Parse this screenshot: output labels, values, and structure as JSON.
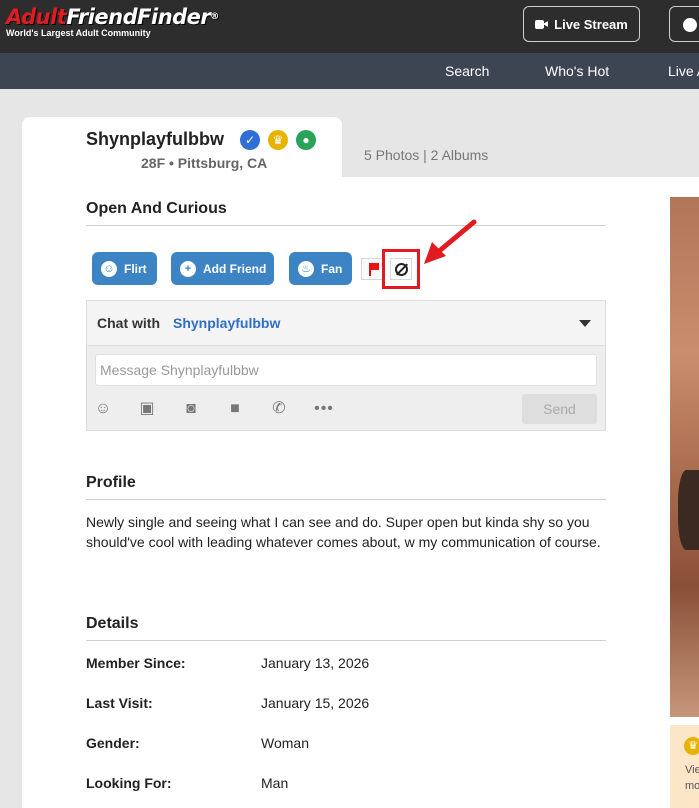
{
  "header": {
    "logo_text_red": "Adult",
    "logo_text_white": "FriendFinder",
    "logo_reg": "®",
    "tagline": "World's Largest Adult Community",
    "live_stream_label": "Live Stream"
  },
  "nav": {
    "items": [
      {
        "label": "Search"
      },
      {
        "label": "Who's Hot"
      },
      {
        "label": "Live A"
      }
    ]
  },
  "profile": {
    "username": "Shynplayfulbbw",
    "meta": "28F • Pittsburg, CA",
    "photos_albums": "5 Photos | 2 Albums",
    "headline": "Open And Curious"
  },
  "actions": {
    "flirt": "Flirt",
    "add_friend": "Add Friend",
    "fan": "Fan"
  },
  "chat": {
    "with_label": "Chat with",
    "name": "Shynplayfulbbw",
    "placeholder": "Message Shynplayfulbbw",
    "value": "",
    "send_label": "Send"
  },
  "sections": {
    "profile_title": "Profile",
    "profile_text": "Newly single and seeing what I can see and do. Super open but kinda shy so you should've cool with leading whatever comes about, w my communication of course.",
    "details_title": "Details"
  },
  "details": [
    {
      "label": "Member Since:",
      "value": "January 13, 2026"
    },
    {
      "label": "Last Visit:",
      "value": "January 15, 2026"
    },
    {
      "label": "Gender:",
      "value": "Woman"
    },
    {
      "label": "Looking For:",
      "value": "Man"
    }
  ],
  "promo": {
    "line1": "Vie",
    "line2": "mo"
  },
  "colors": {
    "brand_red": "#e11b22",
    "button_blue": "#3d84c5",
    "link_blue": "#2f6fc4",
    "nav_bg": "#3d4452",
    "top_bg": "#2d2d2d"
  },
  "icons": [
    "video-camera-icon",
    "chat-bubble-icon",
    "verified-check-icon",
    "crown-icon",
    "user-icon",
    "smile-icon",
    "users-icon",
    "flame-icon",
    "flag-icon",
    "block-icon",
    "emoji-icon",
    "gift-icon",
    "camera-icon",
    "video-icon",
    "phone-icon",
    "more-icon",
    "caret-down-icon"
  ]
}
